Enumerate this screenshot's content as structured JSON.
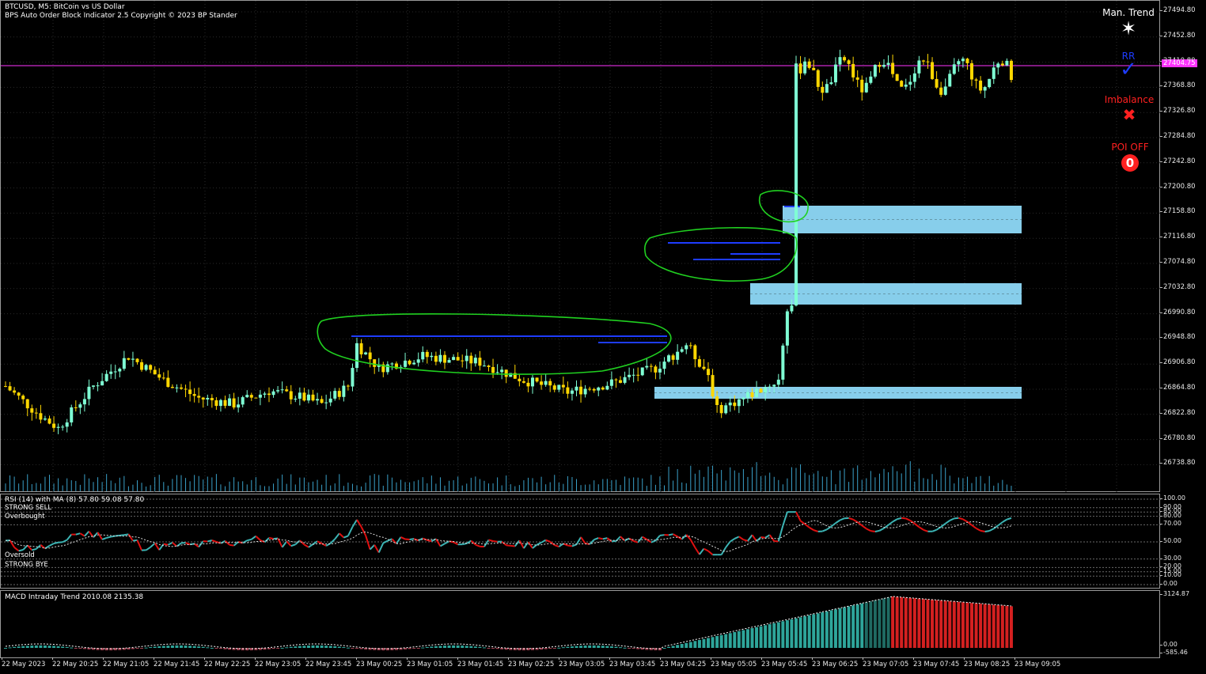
{
  "header": {
    "symbol_line": "BTCUSD, M5:  BitCoin vs US Dollar",
    "indicator_line": "BPS Auto Order Block Indicator  2.5 Copyright © 2023 BP Stander"
  },
  "current_price": "27404.75",
  "price_axis": [
    "27494.80",
    "27452.80",
    "27410.80",
    "27368.80",
    "27326.80",
    "27284.80",
    "27242.80",
    "27200.80",
    "27158.80",
    "27116.80",
    "27074.80",
    "27032.80",
    "26990.80",
    "26948.80",
    "26906.80",
    "26864.80",
    "26822.80",
    "26780.80",
    "26738.80"
  ],
  "side_panel": {
    "trend_label": "Man. Trend",
    "trend_icon": "star-icon",
    "rr_label": "RR",
    "rr_icon": "check-icon",
    "imbalance_label": "Imbalance",
    "imbalance_icon": "x-icon",
    "poi_label": "POI OFF",
    "poi_icon": "zero-circle-icon",
    "colors": {
      "trend": "#ffffff",
      "rr": "#1e3cff",
      "imbalance": "#ff2020",
      "poi": "#ff2020"
    }
  },
  "rsi": {
    "header": "RSI (14) with MA (8) 57.80 59.08 57.80",
    "strong_sell": "STRONG SELL",
    "overbought": "Overbought",
    "oversold": "Oversold",
    "strong_buy": "STRONG BYE",
    "axis": [
      "100.00",
      "90.00",
      "85.00",
      "80.00",
      "70.00",
      "50.00",
      "30.00",
      "20.00",
      "15.00",
      "10.00",
      "0.00"
    ]
  },
  "macd": {
    "header": "MACD Intraday Trend  2010.08 2135.38",
    "axis": [
      "3124.87",
      "0.00",
      "-585.46"
    ]
  },
  "time_axis": [
    "22 May 2023",
    "22 May 20:25",
    "22 May 21:05",
    "22 May 21:45",
    "22 May 22:25",
    "22 May 23:05",
    "22 May 23:45",
    "23 May 00:25",
    "23 May 01:05",
    "23 May 01:45",
    "23 May 02:25",
    "23 May 03:05",
    "23 May 03:45",
    "23 May 04:25",
    "23 May 05:05",
    "23 May 05:45",
    "23 May 06:25",
    "23 May 07:05",
    "23 May 07:45",
    "23 May 08:25",
    "23 May 09:05"
  ],
  "colors": {
    "bull": "#7fffd4",
    "bear": "#ffd700",
    "ob_zone": "#87ceeb",
    "grid": "#2a2a2a",
    "hline": "#ff33ff",
    "ob_line": "#1e3cff",
    "annot": "#20d020",
    "rsi_up": "#3cb4b4",
    "rsi_dn": "#e01010",
    "macd_up": "#2ea59a",
    "macd_dn": "#d42020"
  }
}
